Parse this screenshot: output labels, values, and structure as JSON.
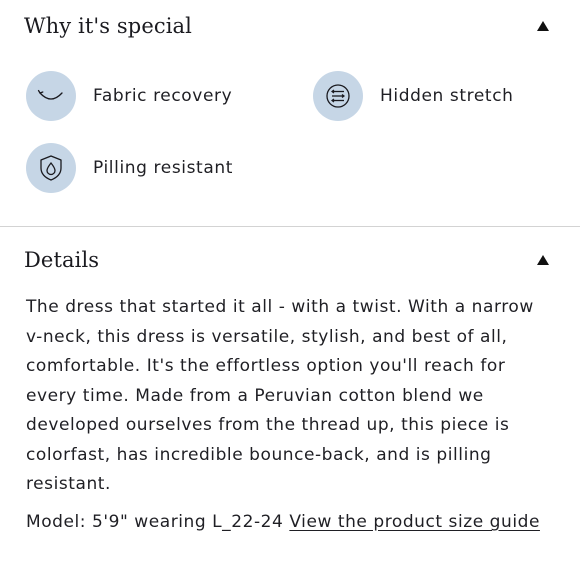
{
  "special": {
    "title": "Why it's special",
    "features": [
      {
        "label": "Fabric recovery",
        "icon": "fabric-recovery-icon"
      },
      {
        "label": "Hidden stretch",
        "icon": "hidden-stretch-icon"
      },
      {
        "label": "Pilling resistant",
        "icon": "pilling-resistant-icon"
      }
    ]
  },
  "details": {
    "title": "Details",
    "description": "The dress that started it all - with a twist. With a narrow v-neck, this dress is versatile, stylish, and best of all, comfortable. It's the effortless option you'll reach for every time. Made from a Peruvian cotton blend we developed ourselves from the thread up, this piece is colorfast, has incredible bounce-back, and is pilling resistant.",
    "model_prefix": "Model: 5'9\" wearing L_22-24",
    "size_guide_link": "View the product size guide"
  },
  "colors": {
    "icon_bg": "#c6d6e6",
    "text": "#1f1f24",
    "divider": "#d3d3d3"
  }
}
